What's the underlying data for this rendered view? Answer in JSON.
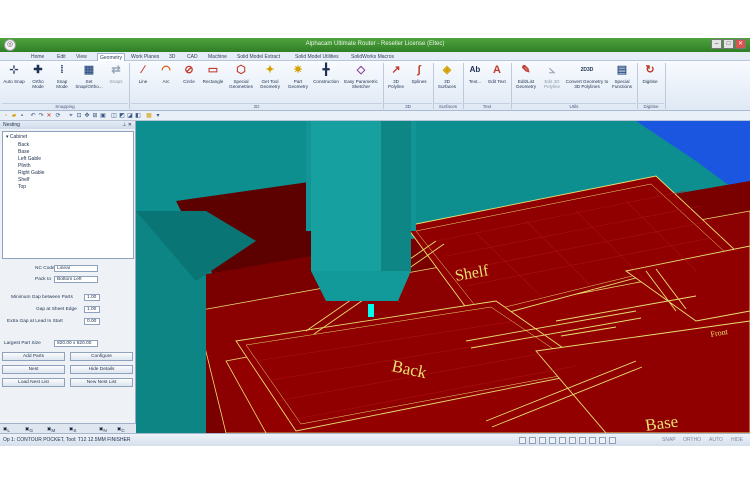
{
  "window": {
    "title": "Alphacam Ultimate Router - Reseller License (Eltec)"
  },
  "tabs": [
    "Home",
    "Edit",
    "View",
    "Geometry",
    "Work Planes",
    "3D",
    "CAD",
    "Machine",
    "Solid Model Extract",
    "Solid Model Utilities",
    "SolidWorks Macros"
  ],
  "active_tab": "Geometry",
  "ribbon": {
    "buttons": [
      {
        "label": "Auto Snap",
        "icon": "snap-icon",
        "glyph": "⊹"
      },
      {
        "label": "Ortho Mode",
        "icon": "ortho-icon",
        "glyph": "✚"
      },
      {
        "label": "Snap Mode",
        "icon": "snap-grid-icon",
        "glyph": "⁞"
      },
      {
        "label": "Set Snap/Ortho...",
        "icon": "snap-settings-icon",
        "glyph": "▦"
      },
      {
        "label": "Snaps",
        "icon": "snaps-icon",
        "glyph": "⇄"
      },
      {
        "label": "Line",
        "icon": "line-icon",
        "glyph": "∕"
      },
      {
        "label": "Arc",
        "icon": "arc-icon",
        "glyph": "◠"
      },
      {
        "label": "Circle",
        "icon": "circle-icon",
        "glyph": "⊘"
      },
      {
        "label": "Rectangle",
        "icon": "rectangle-icon",
        "glyph": "▭"
      },
      {
        "label": "Special Geometries",
        "icon": "special-geometry-icon",
        "glyph": "⬡"
      },
      {
        "label": "Get Tool Geometry",
        "icon": "tool-geometry-icon",
        "glyph": "✦"
      },
      {
        "label": "Part Geometry",
        "icon": "part-geometry-icon",
        "glyph": "✷"
      },
      {
        "label": "Construction",
        "icon": "construction-icon",
        "glyph": "╋"
      },
      {
        "label": "Easy Parametric Sketcher",
        "icon": "parametric-sketch-icon",
        "glyph": "◇"
      },
      {
        "label": "3D Polyline",
        "icon": "polyline-3d-icon",
        "glyph": "↗"
      },
      {
        "label": "Splines",
        "icon": "spline-icon",
        "glyph": "∫"
      },
      {
        "label": "3D Surfaces",
        "icon": "surface-3d-icon",
        "glyph": "◈"
      },
      {
        "label": "Text...",
        "icon": "text-icon",
        "glyph": "Ab"
      },
      {
        "label": "Edit Text",
        "icon": "edit-text-icon",
        "glyph": "A"
      },
      {
        "label": "Edit/List Geometry",
        "icon": "edit-list-icon",
        "glyph": "✎"
      },
      {
        "label": "Edit 3D Polyline",
        "icon": "edit-3d-polyline-icon",
        "glyph": "⦣"
      },
      {
        "label": "Convert Geometry to 3D Polylines",
        "icon": "convert-3d-icon",
        "glyph": "2D3D"
      },
      {
        "label": "Special Functions",
        "icon": "special-functions-icon",
        "glyph": "▤"
      },
      {
        "label": "Digitise",
        "icon": "digitise-icon",
        "glyph": "↻"
      }
    ],
    "groups": [
      "Snapping",
      "2D",
      "3D",
      "Surfaces",
      "Text",
      "Utils",
      "Digitise"
    ]
  },
  "panel": {
    "title": "Nesting",
    "tree_root": "Cabinet",
    "tree_items": [
      "Back",
      "Base",
      "Left Gable",
      "Plinth",
      "Right Gable",
      "Shelf",
      "Top"
    ],
    "nc_code_label": "NC Code",
    "nc_code_value": "Linear",
    "pack_to_label": "Pack to",
    "pack_to_value": "Bottom Left",
    "min_gap_label": "Minimum Gap between Parts",
    "min_gap_value": "1.00",
    "sheet_gap_label": "Gap at Sheet Edge",
    "sheet_gap_value": "1.00",
    "lead_gap_label": "Extra Gap at Lead In Start",
    "lead_gap_value": "0.00",
    "largest_label": "Largest Part Size",
    "largest_value": "820.00 x 620.00",
    "buttons": {
      "add_parts": "Add Parts",
      "configure": "Configure",
      "nest": "Nest",
      "hide_details": "Hide Details",
      "load_nest": "Load Nest List",
      "new_nest": "New Nest List"
    },
    "bottom_tabs": [
      "L",
      "G",
      "M",
      "S",
      "N",
      "C"
    ]
  },
  "viewport": {
    "labels": [
      "Shelf",
      "Back",
      "Base",
      "Front"
    ]
  },
  "status": {
    "text": "Op 1: CONTOUR POCKET, Tool: T12 12.5MM FINISHER",
    "toggles": [
      "SNAP",
      "ORTHO",
      "AUTO",
      "HIDE"
    ]
  },
  "colors": {
    "titlebar": "#3f9a35",
    "panel_bg": "#eef2f7",
    "viewport_cyan": "#0c8c8c",
    "material_red": "#8b0000",
    "toolpath_yellow": "#e8e070"
  }
}
